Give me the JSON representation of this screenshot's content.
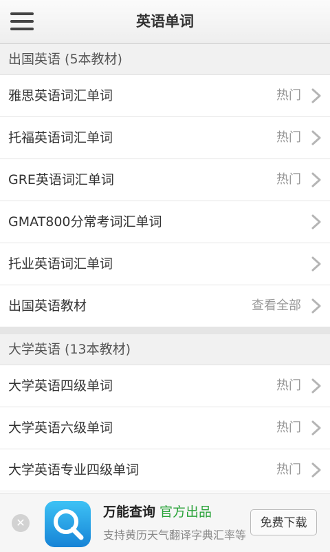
{
  "header": {
    "title": "英语单词",
    "menu_icon": "hamburger-menu-icon"
  },
  "sections": [
    {
      "title": "出国英语 (5本教材)",
      "items": [
        {
          "label": "雅思英语词汇单词",
          "hint": "热门"
        },
        {
          "label": "托福英语词汇单词",
          "hint": "热门"
        },
        {
          "label": "GRE英语词汇单词",
          "hint": "热门"
        },
        {
          "label": "GMAT800分常考词汇单词",
          "hint": ""
        },
        {
          "label": "托业英语词汇单词",
          "hint": ""
        },
        {
          "label": "出国英语教材",
          "hint": "查看全部"
        }
      ]
    },
    {
      "title": "大学英语 (13本教材)",
      "items": [
        {
          "label": "大学英语四级单词",
          "hint": "热门"
        },
        {
          "label": "大学英语六级单词",
          "hint": "热门"
        },
        {
          "label": "大学英语专业四级单词",
          "hint": "热门"
        }
      ]
    }
  ],
  "ad": {
    "app_name": "万能查询",
    "tag": "官方出品",
    "description": "支持黄历天气翻译字典汇率等",
    "button_label": "免费下载",
    "close_symbol": "✕"
  },
  "colors": {
    "tag_green": "#2aa33a",
    "logo_blue": "#1683d6",
    "hint_gray": "#999999"
  }
}
